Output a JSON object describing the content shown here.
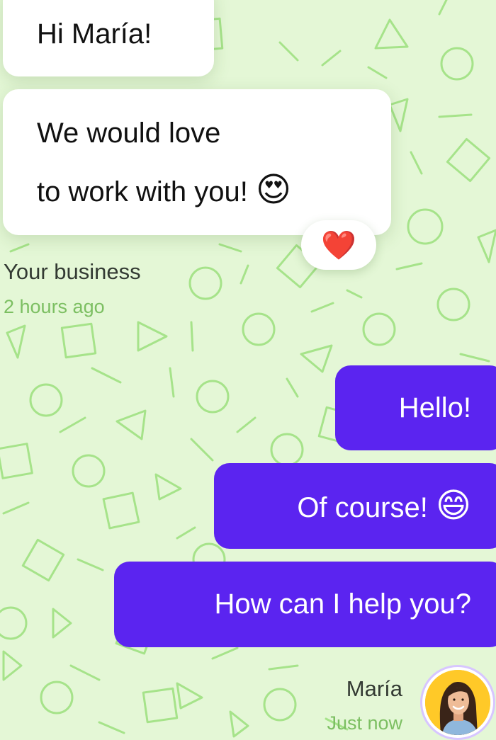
{
  "colors": {
    "background": "#e4f7d6",
    "pattern_stroke": "#a6e38a",
    "incoming_bubble": "#ffffff",
    "outgoing_bubble": "#5b24f0",
    "timestamp": "#7cbf62",
    "avatar_background": "#ffc928"
  },
  "incoming": {
    "messages": [
      {
        "text": "Hi María!"
      },
      {
        "line1": "We would love",
        "line2": "to work with you!",
        "emoji": "😍",
        "emoji_icon": "heart-eyes-emoji"
      }
    ],
    "reaction": {
      "emoji": "❤️",
      "icon": "red-heart-emoji"
    },
    "sender": "Your business",
    "time": "2 hours ago"
  },
  "outgoing": {
    "messages": [
      {
        "text": "Hello!"
      },
      {
        "text": "Of course!",
        "emoji": "😄",
        "emoji_icon": "grinning-emoji"
      },
      {
        "text": "How can I help you?"
      }
    ],
    "sender": "María",
    "time": "Just now",
    "avatar_icon": "user-avatar"
  }
}
